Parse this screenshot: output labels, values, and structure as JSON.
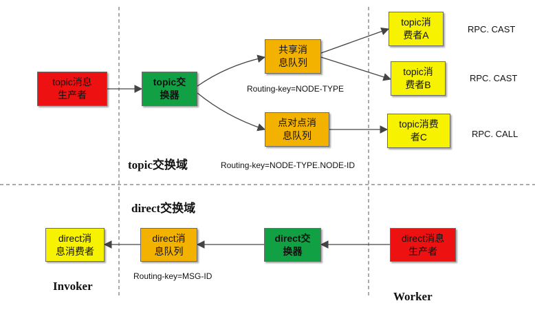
{
  "colors": {
    "producer": "#ee1111",
    "exchange": "#11a044",
    "consumer": "#f7f200",
    "queue": "#f3b200"
  },
  "topic": {
    "producer": "topic消息\n生产者",
    "exchange": "topic交\n换器",
    "queue_shared": "共享消\n息队列",
    "queue_p2p": "点对点消\n息队列",
    "consumer_a": "topic消\n费者A",
    "consumer_b": "topic消\n费者B",
    "consumer_c": "topic消费\n者C",
    "routing_key_shared": "Routing-key=NODE-TYPE",
    "routing_key_p2p": "Routing-key=NODE-TYPE.NODE-ID",
    "rpc_a": "RPC. CAST",
    "rpc_b": "RPC. CAST",
    "rpc_c": "RPC. CALL",
    "domain_label": "topic交换域"
  },
  "direct": {
    "domain_label": "direct交换域",
    "consumer": "direct消\n息消费者",
    "queue": "direct消\n息队列",
    "exchange": "direct交\n换器",
    "producer": "direct消息\n生产者",
    "routing_key": "Routing-key=MSG-ID"
  },
  "sides": {
    "invoker": "Invoker",
    "worker": "Worker"
  }
}
